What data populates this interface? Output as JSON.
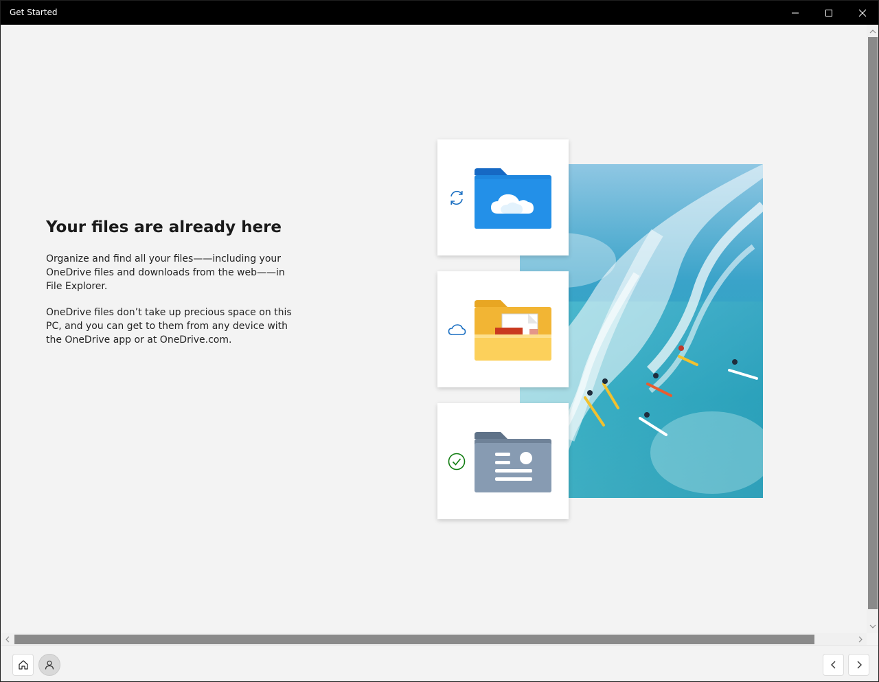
{
  "window": {
    "title": "Get Started",
    "controls": [
      "minimize",
      "maximize",
      "close"
    ]
  },
  "page": {
    "heading": "Your files are already here",
    "paragraph1": "Organize and find all your files——including your OneDrive files and downloads from the web——in File Explorer.",
    "paragraph2": "OneDrive files don’t take up precious space on this PC, and you can get to them from any device with the OneDrive app or at OneDrive.com."
  },
  "illustration": {
    "cards": [
      {
        "status_icon": "sync-icon",
        "folder": "onedrive-cloud-folder-icon"
      },
      {
        "status_icon": "cloud-icon",
        "folder": "yellow-documents-folder-icon"
      },
      {
        "status_icon": "check-circle-icon",
        "folder": "gray-contacts-folder-icon"
      }
    ],
    "photo": "surfers-on-wave-photo"
  },
  "footer": {
    "left_buttons": [
      "home-icon",
      "user-icon"
    ],
    "right_buttons": [
      "chevron-left-icon",
      "chevron-right-icon"
    ]
  },
  "colors": {
    "titlebar": "#000000",
    "background": "#f3f3f3",
    "accent_blue": "#1a7bd1",
    "folder_yellow": "#f7c948",
    "check_green": "#107c10"
  }
}
